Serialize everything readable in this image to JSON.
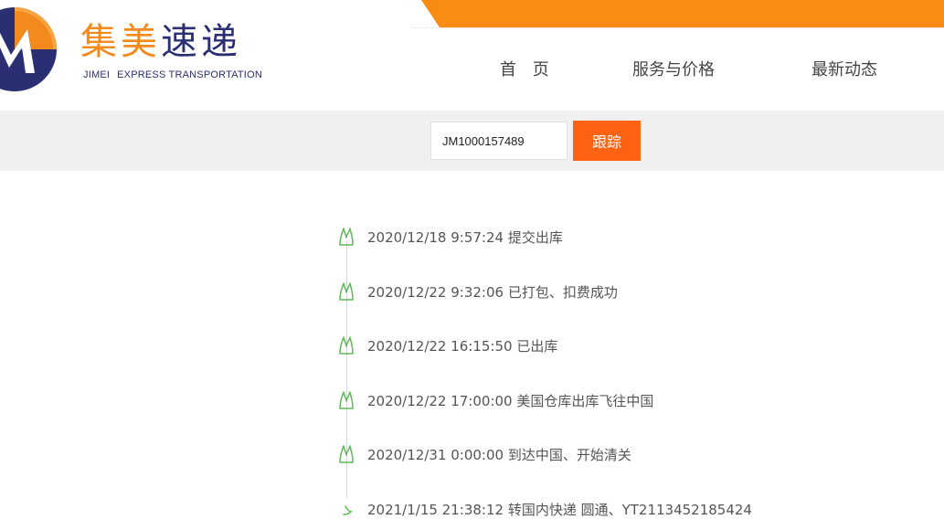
{
  "brand": {
    "name_cn_part1": "集美",
    "name_cn_part2": "速递",
    "name_en_part1": "JIMEI",
    "name_en_part2": "EXPRESS TRANSPORTATION",
    "orange": "#f98c13",
    "navy": "#2a2e73",
    "logo_icon": "m-logo-icon"
  },
  "nav": {
    "home": "首 页",
    "services": "服务与价格",
    "news": "最新动态"
  },
  "search": {
    "value": "JM1000157489",
    "button_label": "跟踪",
    "button_color": "#fe6212"
  },
  "timeline": {
    "icon": "leaf-icon",
    "icon_color": "#5fb85a",
    "events": [
      {
        "text": "2020/12/18 9:57:24 提交出库"
      },
      {
        "text": "2020/12/22 9:32:06 已打包、扣费成功"
      },
      {
        "text": "2020/12/22 16:15:50 已出库"
      },
      {
        "text": "2020/12/22 17:00:00 美国仓库出库飞往中国"
      },
      {
        "text": "2020/12/31 0:00:00 到达中国、开始清关"
      },
      {
        "text": "2021/1/15 21:38:12 转国内快递 圆通、YT2113452185424"
      }
    ]
  }
}
